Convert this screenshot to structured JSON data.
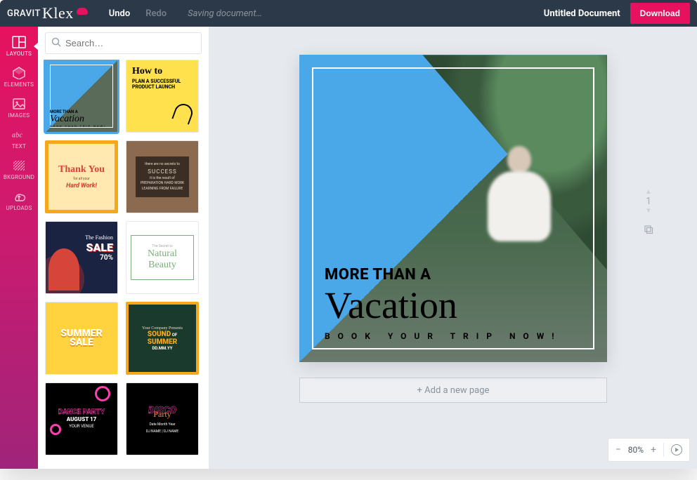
{
  "brand": {
    "part1": "GRAVIT",
    "part2": "Klex"
  },
  "undo": "Undo",
  "redo": "Redo",
  "saving": "Saving document…",
  "doc_title": "Untitled Document",
  "download": "Download",
  "nav": {
    "layouts": "LAYOUTS",
    "elements": "ELEMENTS",
    "images": "IMAGES",
    "text": "TEXT",
    "bkground": "BKGROUND",
    "uploads": "UPLOADS"
  },
  "search_placeholder": "Search…",
  "thumbs": {
    "t1": {
      "s1": "MORE THAN A",
      "s2": "Vacation",
      "s3": "BOOK YOUR TRIP NOW!"
    },
    "t2": {
      "t1": "How to",
      "t2": "PLAN A SUCCESSFUL PRODUCT LAUNCH"
    },
    "t3": {
      "t1": "Thank You",
      "t2": "for all your",
      "t3": "Hard Work!"
    },
    "t4": {
      "small": "there are no secrets to",
      "big": "SUCCESS",
      "rest": "it is the result of PREPARATION HARD WORK LEARNING FROM FAILURE"
    },
    "t5": {
      "t0": "The Fashion",
      "t1": "SALE",
      "t2": "70%"
    },
    "t6": {
      "t0": "The Secret to",
      "t1": "Natural Beauty"
    },
    "t7": {
      "t1": "SUMMER",
      "t2": "SALE"
    },
    "t8": {
      "t0": "Your Company Presents",
      "t1": "SOUND",
      "of": "OF",
      "t2": "SUMMER",
      "date": "DD.MM.YY"
    },
    "t9": {
      "t1": "DANCE PARTY",
      "t2": "AUGUST 17",
      "t3": "YOUR VENUE"
    },
    "t10": {
      "t1": "DISCO",
      "t1b": "Party",
      "t2": "Date Month Year",
      "t3": "DJ NAME | DJ NAME"
    }
  },
  "canvas": {
    "l1": "MORE THAN A",
    "l2": "Vacation",
    "l3": "BOOK YOUR TRIP NOW!"
  },
  "page_number": "1",
  "add_page": "+ Add a new page",
  "zoom": {
    "minus": "−",
    "value": "80%",
    "plus": "+"
  }
}
